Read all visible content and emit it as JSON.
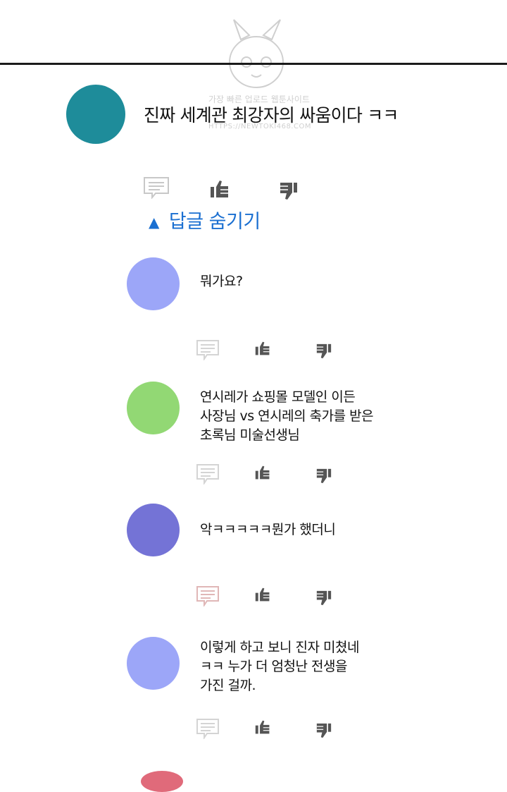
{
  "main_comment": {
    "text": "진짜 세계관 최강자의 싸움이다 ㅋㅋ",
    "avatar_color": "#1e8c9a"
  },
  "reply_toggle": {
    "label": "답글 숨기기",
    "color": "#1a6fd1"
  },
  "replies": [
    {
      "text": "뭐가요?",
      "avatar_color": "#9ca6f8"
    },
    {
      "text": "연시레가 쇼핑몰 모델인 이든\n사장님 vs 연시레의 축가를 받은\n초록님 미술선생님",
      "avatar_color": "#92d874"
    },
    {
      "text": "악ㅋㅋㅋㅋㅋ뭔가 했더니",
      "avatar_color": "#7473d6"
    },
    {
      "text": "이렇게 하고 보니 진자 미쳤네\nㅋㅋ 누가 더 엄청난 전생을\n가진 걸까.",
      "avatar_color": "#9ca6f8"
    }
  ],
  "icons": {
    "reply": "comment-icon",
    "like": "thumbs-up-icon",
    "dislike": "thumbs-down-icon"
  },
  "watermark": {
    "line1": "가장 빠른 업로드 웹툰사이트",
    "line2": "HTTPS://NEWTOKI468.COM"
  }
}
